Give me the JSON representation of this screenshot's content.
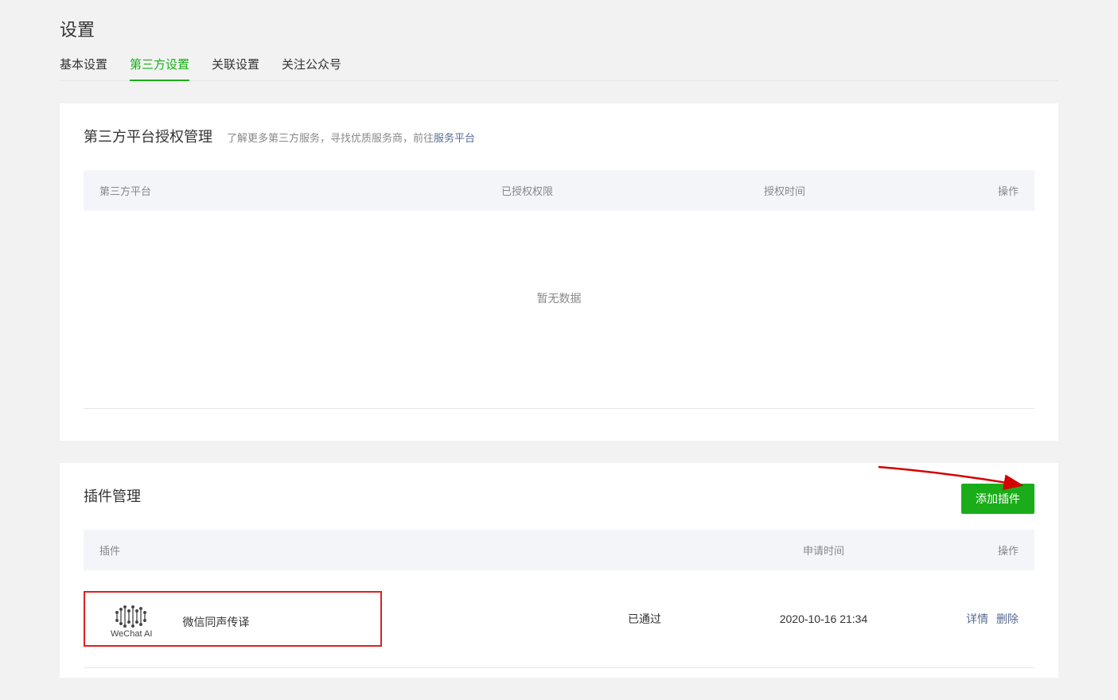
{
  "page_title": "设置",
  "tabs": [
    {
      "label": "基本设置",
      "active": false
    },
    {
      "label": "第三方设置",
      "active": true
    },
    {
      "label": "关联设置",
      "active": false
    },
    {
      "label": "关注公众号",
      "active": false
    }
  ],
  "auth_section": {
    "title": "第三方平台授权管理",
    "desc_prefix": "了解更多第三方服务，寻找优质服务商，前往",
    "desc_link": "服务平台",
    "columns": {
      "platform": "第三方平台",
      "permission": "已授权权限",
      "time": "授权时间",
      "action": "操作"
    },
    "empty_text": "暂无数据"
  },
  "plugin_section": {
    "title": "插件管理",
    "add_button": "添加插件",
    "columns": {
      "plugin": "插件",
      "apply_time": "申请时间",
      "action": "操作"
    },
    "rows": [
      {
        "logo_label": "WeChat AI",
        "name": "微信同声传译",
        "status": "已通过",
        "time": "2020-10-16 21:34",
        "detail_label": "详情",
        "delete_label": "删除"
      }
    ]
  }
}
